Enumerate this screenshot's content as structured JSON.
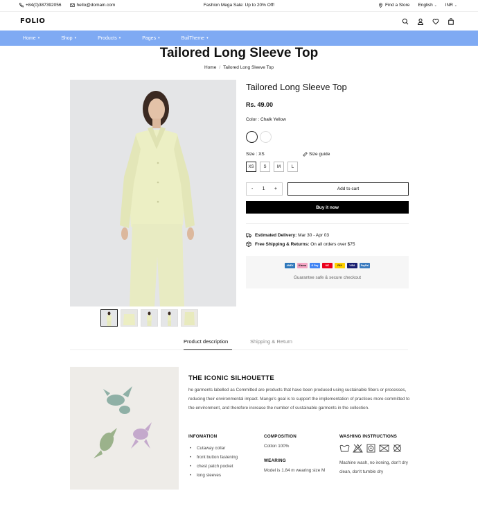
{
  "topbar": {
    "phone": "+84(0)387392056",
    "email": "hello@domain.com",
    "promo": "Fashion Mega Sale: Up to 20% Off!",
    "find_store": "Find a Store",
    "language": "English",
    "currency": "INR"
  },
  "header": {
    "logo": "FOLIO",
    "icons": [
      "search-icon",
      "user-icon",
      "heart-icon",
      "bag-icon"
    ]
  },
  "nav": {
    "items": [
      {
        "label": "Home"
      },
      {
        "label": "Shop"
      },
      {
        "label": "Products"
      },
      {
        "label": "Pages"
      },
      {
        "label": "BuilTheme"
      }
    ],
    "background": "#7faaf3"
  },
  "page": {
    "title": "Tailored Long Sleeve Top",
    "breadcrumb": [
      "Home",
      "Tailored Long Sleeve Top"
    ]
  },
  "product": {
    "title": "Tailored Long Sleeve Top",
    "price": "Rs. 49.00",
    "color_label": "Color :",
    "color_value": "Chalk Yellow",
    "size_label": "Size :",
    "size_value": "XS",
    "size_guide": "Size guide",
    "sizes": [
      "XS",
      "S",
      "M",
      "L"
    ],
    "quantity": "1",
    "qty_minus": "-",
    "qty_plus": "+",
    "add_to_cart": "Add to cart",
    "buy_now": "Buy it now",
    "delivery_label": "Estimated Delivery:",
    "delivery_value": "Mar 30 - Apr 03",
    "shipping_label": "Free Shipping & Returns:",
    "shipping_value": "On all orders over $75",
    "payments": [
      {
        "name": "AMEX",
        "color": "#2e77bb"
      },
      {
        "name": "Klarna",
        "color": "#f4a6c4"
      },
      {
        "name": "G Pay",
        "color": "#4285f4"
      },
      {
        "name": "MC",
        "color": "#eb001b"
      },
      {
        "name": "PAY",
        "color": "#ffd000"
      },
      {
        "name": "VISA",
        "color": "#1a1f71"
      },
      {
        "name": "PayPal",
        "color": "#3b7bbf"
      }
    ],
    "guarantee": "Guarantee safe & secure checkout"
  },
  "tabs": {
    "description": "Product description",
    "shipping": "Shipping & Return"
  },
  "description": {
    "title": "THE ICONIC SILHOUETTE",
    "body": "he garments labelled as Committed are products that have been produced using sustainable fibers or processes, reducing their environmental impact. Mango's goal is to support the implementation of practices more committed to the environment, and therefore increase the number of sustainable garments in the collection.",
    "information": {
      "heading": "INFOMATION",
      "items": [
        "Cutaway collar",
        "front button fastening",
        "chest patch pocket",
        "long sleeves"
      ]
    },
    "composition": {
      "heading": "COMPOSITION",
      "value": "Cotton 100%"
    },
    "wearing": {
      "heading": "WEARING",
      "value": "Model is 1.84 m wearing size M"
    },
    "washing": {
      "heading": "WASHING INSTRUCTIONS",
      "icons": [
        "machine-wash-icon",
        "no-bleach-icon",
        "no-iron-icon",
        "no-dry-clean-icon",
        "no-tumble-dry-icon"
      ],
      "text": "Machine wash, no ironing, don't dry clean, don't tumble dry"
    }
  }
}
